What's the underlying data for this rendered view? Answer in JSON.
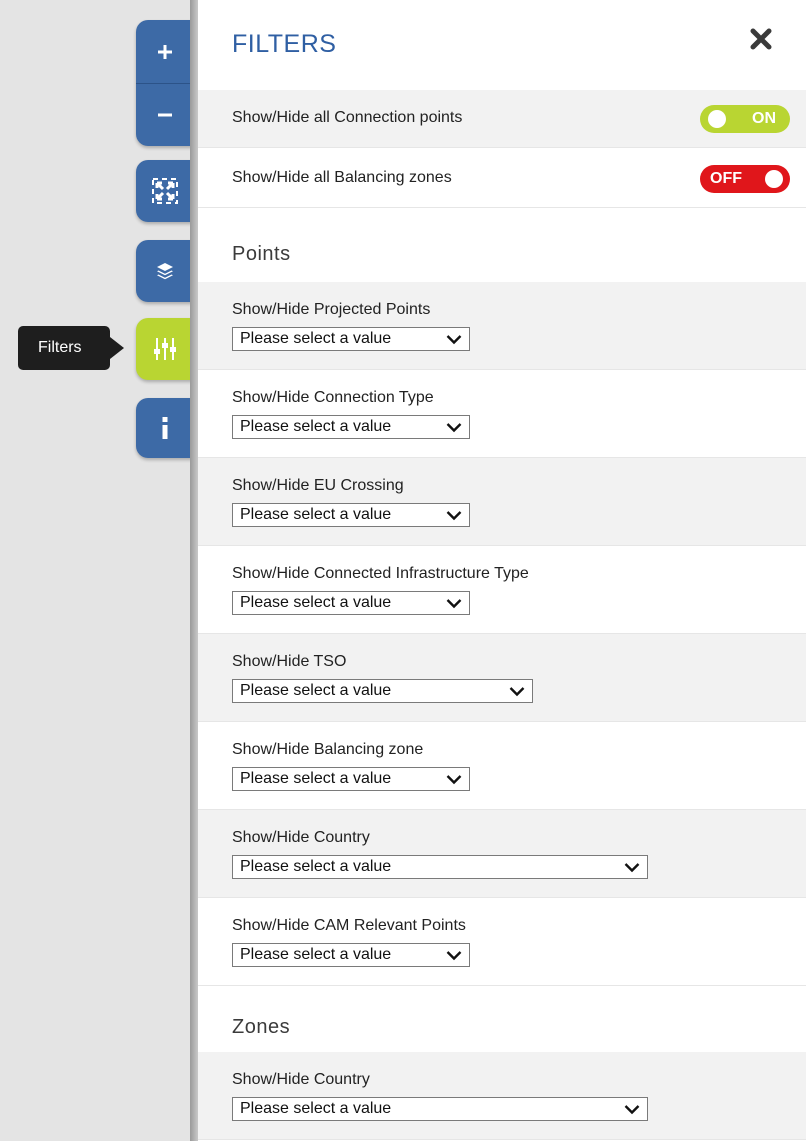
{
  "map_controls": {
    "tooltip": "Filters"
  },
  "panel": {
    "title": "FILTERS",
    "toggles": [
      {
        "label": "Show/Hide all Connection points",
        "state": "ON"
      },
      {
        "label": "Show/Hide all Balancing zones",
        "state": "OFF"
      }
    ],
    "points_heading": "Points",
    "points_filters": [
      {
        "label": "Show/Hide Projected Points",
        "value": "Please select a value"
      },
      {
        "label": "Show/Hide Connection Type",
        "value": "Please select a value"
      },
      {
        "label": "Show/Hide EU Crossing",
        "value": "Please select a value"
      },
      {
        "label": "Show/Hide Connected Infrastructure Type",
        "value": "Please select a value"
      },
      {
        "label": "Show/Hide TSO",
        "value": "Please select a value"
      },
      {
        "label": "Show/Hide Balancing zone",
        "value": "Please select a value"
      },
      {
        "label": "Show/Hide Country",
        "value": "Please select a value"
      },
      {
        "label": "Show/Hide CAM Relevant Points",
        "value": "Please select a value"
      }
    ],
    "zones_heading": "Zones",
    "zones_filters": [
      {
        "label": "Show/Hide Country",
        "value": "Please select a value"
      }
    ]
  },
  "colors": {
    "control_blue": "#3d6aa6",
    "active_green": "#b9d532",
    "off_red": "#e0161b",
    "title_blue": "#2f5fa3"
  },
  "icons": [
    "plus-icon",
    "minus-icon",
    "fullscreen-icon",
    "layers-icon",
    "filters-icon",
    "info-icon",
    "close-icon",
    "chevron-down-icon"
  ]
}
